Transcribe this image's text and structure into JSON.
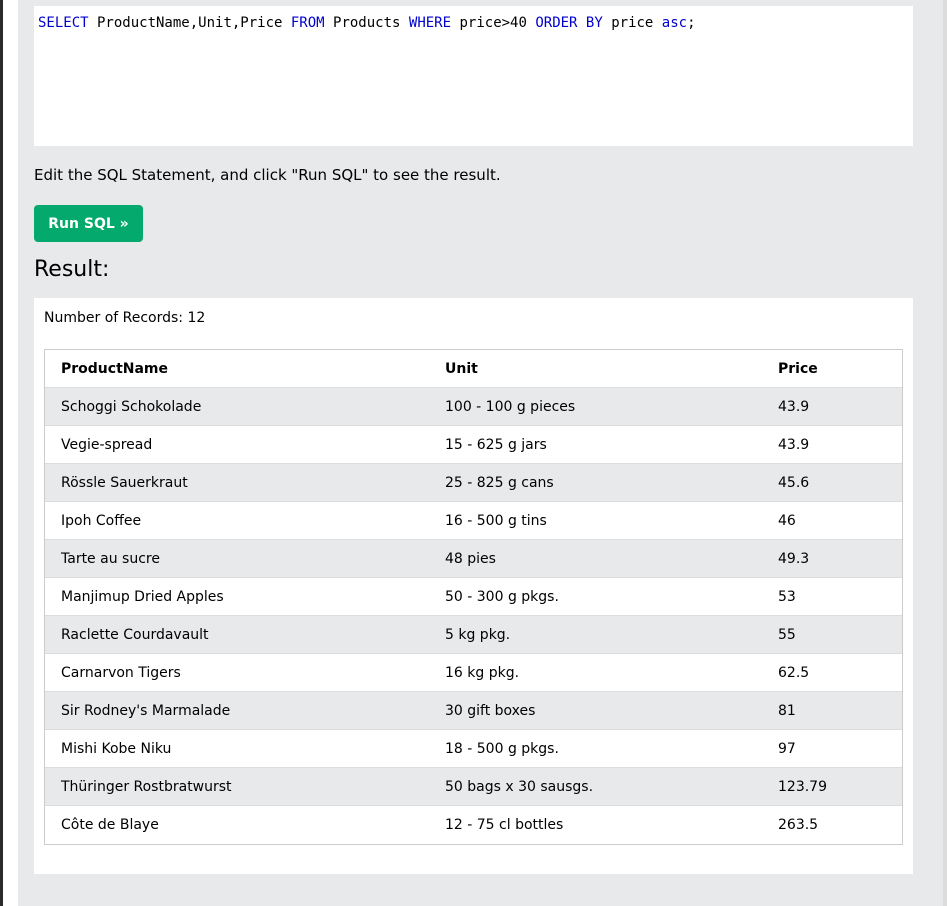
{
  "editor": {
    "tokens": [
      {
        "text": "SELECT",
        "kw": true
      },
      {
        "text": " ProductName,Unit,Price ",
        "kw": false
      },
      {
        "text": "FROM",
        "kw": true
      },
      {
        "text": " Products ",
        "kw": false
      },
      {
        "text": "WHERE",
        "kw": true
      },
      {
        "text": " price>40 ",
        "kw": false
      },
      {
        "text": "ORDER BY",
        "kw": true
      },
      {
        "text": " price ",
        "kw": false
      },
      {
        "text": "asc",
        "kw": true
      },
      {
        "text": ";",
        "kw": false
      }
    ]
  },
  "instructions": "Edit the SQL Statement, and click \"Run SQL\" to see the result.",
  "run_button_label": "Run SQL »",
  "result_heading": "Result:",
  "records_text": "Number of Records: 12",
  "colors": {
    "keyword": "#0000cd",
    "run_button": "#04aa6d",
    "panel_bg": "#e7e9eb"
  },
  "table": {
    "headers": [
      "ProductName",
      "Unit",
      "Price"
    ],
    "rows": [
      [
        "Schoggi Schokolade",
        "100 - 100 g pieces",
        "43.9"
      ],
      [
        "Vegie-spread",
        "15 - 625 g jars",
        "43.9"
      ],
      [
        "Rössle Sauerkraut",
        "25 - 825 g cans",
        "45.6"
      ],
      [
        "Ipoh Coffee",
        "16 - 500 g tins",
        "46"
      ],
      [
        "Tarte au sucre",
        "48 pies",
        "49.3"
      ],
      [
        "Manjimup Dried Apples",
        "50 - 300 g pkgs.",
        "53"
      ],
      [
        "Raclette Courdavault",
        "5 kg pkg.",
        "55"
      ],
      [
        "Carnarvon Tigers",
        "16 kg pkg.",
        "62.5"
      ],
      [
        "Sir Rodney's Marmalade",
        "30 gift boxes",
        "81"
      ],
      [
        "Mishi Kobe Niku",
        "18 - 500 g pkgs.",
        "97"
      ],
      [
        "Thüringer Rostbratwurst",
        "50 bags x 30 sausgs.",
        "123.79"
      ],
      [
        "Côte de Blaye",
        "12 - 75 cl bottles",
        "263.5"
      ]
    ]
  }
}
